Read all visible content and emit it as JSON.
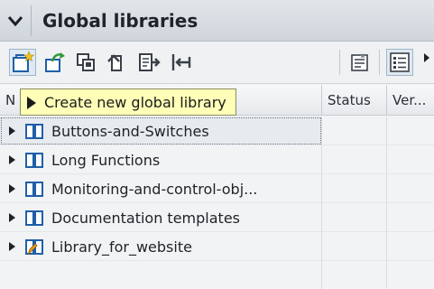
{
  "header": {
    "title": "Global libraries",
    "collapse_icon": "chevron-down-icon"
  },
  "toolbar": {
    "buttons": [
      {
        "name": "create-new-library-icon"
      },
      {
        "name": "open-library-icon"
      },
      {
        "name": "save-library-icon"
      },
      {
        "name": "close-library-icon"
      },
      {
        "name": "update-library-icon"
      },
      {
        "name": "export-icon"
      },
      {
        "name": "properties-icon"
      },
      {
        "name": "list-view-icon"
      }
    ]
  },
  "tooltip": {
    "text": "Create new global library"
  },
  "columns": {
    "name": "N",
    "status": "Status",
    "version": "Ver..."
  },
  "rows": [
    {
      "label": "Buttons-and-Switches",
      "icon": "library-book-icon"
    },
    {
      "label": "Long Functions",
      "icon": "library-book-icon"
    },
    {
      "label": "Monitoring-and-control-obj...",
      "icon": "library-book-icon"
    },
    {
      "label": "Documentation templates",
      "icon": "library-book-icon"
    },
    {
      "label": "Library_for_website",
      "icon": "library-edit-icon"
    }
  ],
  "colors": {
    "accent_blue": "#1f5fa8",
    "tooltip_bg": "#ffffb8",
    "new_star": "#f0c419"
  }
}
